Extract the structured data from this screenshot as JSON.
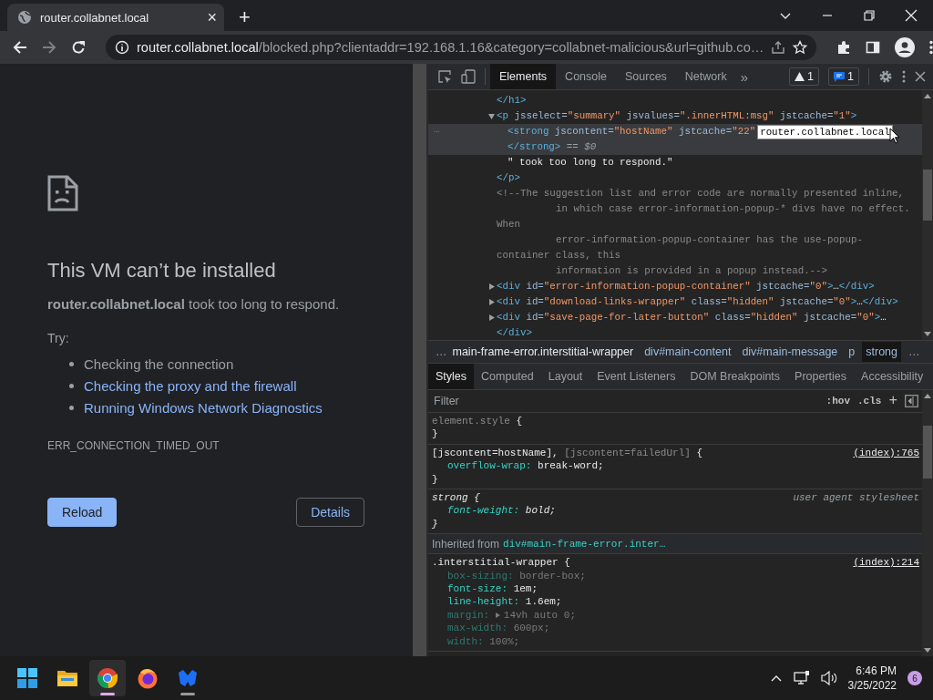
{
  "browser": {
    "tab": {
      "title": "router.collabnet.local",
      "close": "×"
    },
    "new_tab": "+",
    "address_bar": {
      "host": "router.collabnet.local",
      "path": "/blocked.php?clientaddr=192.168.1.16&category=collabnet-malicious&url=github.co…"
    }
  },
  "page": {
    "heading": "This VM can’t be installed",
    "summary": "**router.collabnet.local** took too long to respond.",
    "try_label": "Try:",
    "suggestions": [
      {
        "text": "Checking the connection",
        "link": false
      },
      {
        "text": "Checking the proxy and the firewall",
        "link": true
      },
      {
        "text": "Running Windows Network Diagnostics",
        "link": true
      }
    ],
    "error_code": "ERR_CONNECTION_TIMED_OUT",
    "buttons": [
      {
        "label": "Reload",
        "primary": true
      },
      {
        "label": "Details",
        "primary": false
      }
    ]
  },
  "devtools": {
    "tabs": [
      {
        "label": "Elements",
        "selected": true
      },
      {
        "label": "Console",
        "selected": false
      },
      {
        "label": "Sources",
        "selected": false
      },
      {
        "label": "Network",
        "selected": false
      }
    ],
    "more": "»",
    "warnings": "1",
    "messages": "1",
    "elements": {
      "tooltip": "router.collabnet.local",
      "rows": [
        {
          "lines": [
            {
              "tokens": [
                {
                  "kind": "tag",
                  "text": "</h1>"
                }
              ]
            }
          ]
        },
        {
          "expanded": true,
          "lines": [
            {
              "tokens": [
                {
                  "kind": "tag",
                  "text": "<p"
                },
                {
                  "kind": "attr",
                  "text": " jsselect="
                },
                {
                  "kind": "val",
                  "text": "\"summary\""
                },
                {
                  "kind": "attr",
                  "text": " jsvalues="
                },
                {
                  "kind": "val",
                  "text": "\".innerHTML:msg\""
                },
                {
                  "kind": "attr",
                  "text": " jstcache="
                },
                {
                  "kind": "val",
                  "text": "\"1\""
                },
                {
                  "kind": "tag",
                  "text": ">"
                }
              ]
            }
          ],
          "children": [
            {
              "selected": true,
              "gutter": "…",
              "lines": [
                {
                  "tokens": [
                    {
                      "kind": "tag",
                      "text": "<strong"
                    },
                    {
                      "kind": "attr",
                      "text": " jscontent="
                    },
                    {
                      "kind": "val",
                      "text": "\"hostName\""
                    },
                    {
                      "kind": "attr",
                      "text": " jstcache="
                    },
                    {
                      "kind": "val",
                      "text": "\"22\""
                    }
                  ],
                  "tooltip": true
                },
                {
                  "tokens": [
                    {
                      "kind": "tag",
                      "text": "</strong>"
                    },
                    {
                      "kind": "dim",
                      "text": " == $0"
                    }
                  ]
                }
              ]
            },
            {
              "lines": [
                {
                  "tokens": [
                    {
                      "kind": "text",
                      "text": "\" took too long to respond.\""
                    }
                  ]
                }
              ]
            }
          ]
        },
        {
          "lines": [
            {
              "tokens": [
                {
                  "kind": "tag",
                  "text": "</p>"
                }
              ]
            }
          ]
        },
        {
          "lines": [
            {
              "tokens": [
                {
                  "kind": "comment",
                  "text": "<!--The suggestion list and error code are normally presented inline,"
                }
              ]
            },
            {
              "continuation": true,
              "tokens": [
                {
                  "kind": "comment",
                  "text": "in which case error-information-popup-* divs have no effect."
                }
              ]
            },
            {
              "tokens": [
                {
                  "kind": "comment",
                  "text": "When"
                }
              ]
            },
            {
              "continuation": true,
              "tokens": [
                {
                  "kind": "comment",
                  "text": "error-information-popup-container has the use-popup-"
                }
              ]
            },
            {
              "tokens": [
                {
                  "kind": "comment",
                  "text": "container class, this"
                }
              ]
            },
            {
              "continuation": true,
              "tokens": [
                {
                  "kind": "comment",
                  "text": "information is provided in a popup instead.-->"
                }
              ]
            }
          ]
        },
        {
          "expanded": false,
          "lines": [
            {
              "tokens": [
                {
                  "kind": "tag",
                  "text": "<div"
                },
                {
                  "kind": "attr",
                  "text": " id="
                },
                {
                  "kind": "val",
                  "text": "\"error-information-popup-container\""
                },
                {
                  "kind": "attr",
                  "text": " jstcache="
                },
                {
                  "kind": "val",
                  "text": "\"0\""
                },
                {
                  "kind": "tag",
                  "text": ">"
                },
                {
                  "kind": "text",
                  "text": "…"
                },
                {
                  "kind": "tag",
                  "text": "</div>"
                }
              ]
            }
          ]
        },
        {
          "expanded": false,
          "lines": [
            {
              "tokens": [
                {
                  "kind": "tag",
                  "text": "<div"
                },
                {
                  "kind": "attr",
                  "text": " id="
                },
                {
                  "kind": "val",
                  "text": "\"download-links-wrapper\""
                },
                {
                  "kind": "attr",
                  "text": " class="
                },
                {
                  "kind": "val",
                  "text": "\"hidden\""
                },
                {
                  "kind": "attr",
                  "text": " jstcache="
                },
                {
                  "kind": "val",
                  "text": "\"0\""
                },
                {
                  "kind": "tag",
                  "text": ">"
                },
                {
                  "kind": "text",
                  "text": "…"
                },
                {
                  "kind": "tag",
                  "text": "</div>"
                }
              ]
            }
          ]
        },
        {
          "expanded": false,
          "lines": [
            {
              "tokens": [
                {
                  "kind": "tag",
                  "text": "<div"
                },
                {
                  "kind": "attr",
                  "text": " id="
                },
                {
                  "kind": "val",
                  "text": "\"save-page-for-later-button\""
                },
                {
                  "kind": "attr",
                  "text": " class="
                },
                {
                  "kind": "val",
                  "text": "\"hidden\""
                },
                {
                  "kind": "attr",
                  "text": " jstcache="
                },
                {
                  "kind": "val",
                  "text": "\"0\""
                },
                {
                  "kind": "tag",
                  "text": ">"
                },
                {
                  "kind": "text",
                  "text": "…"
                }
              ]
            },
            {
              "tokens": [
                {
                  "kind": "tag",
                  "text": "</div>"
                }
              ]
            }
          ]
        }
      ]
    },
    "breadcrumbs": {
      "lead": "…",
      "items": [
        {
          "label": "main-frame-error.interstitial-wrapper",
          "selected": false
        },
        {
          "label": "div#main-content",
          "selected": false
        },
        {
          "label": "div#main-message",
          "selected": false
        },
        {
          "label": "p",
          "selected": false
        },
        {
          "label": "strong",
          "selected": true
        }
      ],
      "trail": "…"
    },
    "sidebar_tabs": [
      {
        "label": "Styles",
        "selected": true
      },
      {
        "label": "Computed",
        "selected": false
      },
      {
        "label": "Layout",
        "selected": false
      },
      {
        "label": "Event Listeners",
        "selected": false
      },
      {
        "label": "DOM Breakpoints",
        "selected": false
      },
      {
        "label": "Properties",
        "selected": false
      },
      {
        "label": "Accessibility",
        "selected": false
      }
    ],
    "filter": {
      "placeholder": "Filter",
      "hov": ":hov",
      "cls": ".cls",
      "add": "+"
    },
    "rules": [
      {
        "kind": "rule",
        "selector": [
          {
            "kind": "dim",
            "text": "element.style"
          },
          {
            "kind": "sel",
            "text": " {"
          }
        ],
        "close": "}"
      },
      {
        "kind": "rule",
        "selector": [
          {
            "kind": "sel",
            "text": "[jscontent=hostName]"
          },
          {
            "kind": "sel",
            "text": ", "
          },
          {
            "kind": "dim",
            "text": "[jscontent=failedUrl]"
          },
          {
            "kind": "sel",
            "text": " {"
          }
        ],
        "source": "(index):765",
        "properties": [
          {
            "name": "overflow-wrap:",
            "value": "break-word;",
            "active": true
          }
        ],
        "close": "}"
      },
      {
        "kind": "user-agent",
        "selector": [
          {
            "kind": "sel",
            "text": "strong {"
          }
        ],
        "source": "user agent stylesheet",
        "properties": [
          {
            "name": "font-weight:",
            "value": "bold;",
            "active": true
          }
        ],
        "close": "}"
      },
      {
        "kind": "inherited",
        "label": "Inherited from",
        "from": "div#main-frame-error.inter…"
      },
      {
        "kind": "rule",
        "selector": [
          {
            "kind": "sel",
            "text": ".interstitial-wrapper {"
          }
        ],
        "source": "(index):214",
        "properties": [
          {
            "name": "box-sizing:",
            "value": "border-box;",
            "active": false
          },
          {
            "name": "font-size:",
            "value": "1em;",
            "active": true
          },
          {
            "name": "line-height:",
            "value": "1.6em;",
            "active": true
          },
          {
            "name": "margin:",
            "value": "14vh auto 0;",
            "active": false,
            "expandable": true
          },
          {
            "name": "max-width:",
            "value": "600px;",
            "active": false
          },
          {
            "name": "width:",
            "value": "100%;",
            "active": false
          }
        ]
      }
    ]
  },
  "taskbar": {
    "apps": [
      {
        "kind": "start",
        "running": false,
        "active": false
      },
      {
        "kind": "folder",
        "running": false,
        "active": false
      },
      {
        "kind": "chrome",
        "running": true,
        "active": true
      },
      {
        "kind": "firefox",
        "running": false,
        "active": false
      },
      {
        "kind": "shield",
        "running": true,
        "active": false
      }
    ],
    "time": "6:46 PM",
    "date": "3/25/2022",
    "notifications": "6"
  }
}
